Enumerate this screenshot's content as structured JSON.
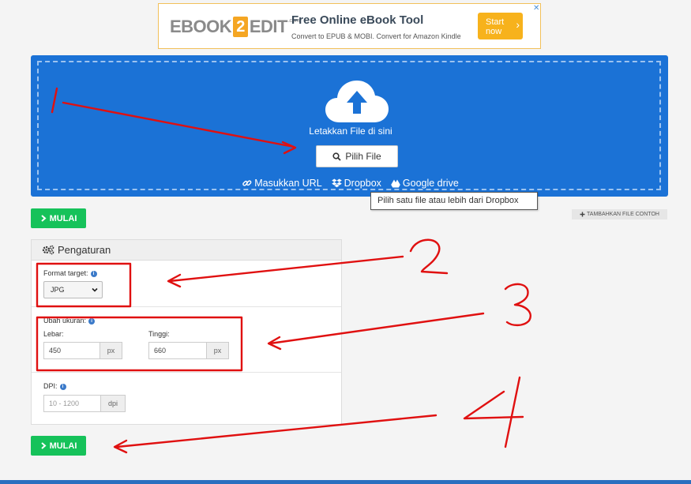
{
  "ad": {
    "logo_left": "EBOOK",
    "logo_num": "2",
    "logo_right": "EDIT",
    "logo_suffix": ".com",
    "title": "Free Online eBook Tool",
    "subtitle": "Convert to EPUB & MOBI. Convert for Amazon Kindle",
    "start_line1": "Start",
    "start_line2": "now",
    "close": "✕"
  },
  "upload": {
    "drop_text": "Letakkan File di sini",
    "pick_label": "Pilih File",
    "url_label": "Masukkan URL",
    "dropbox_label": "Dropbox",
    "gdrive_label": "Google drive"
  },
  "tooltip": "Pilih satu file atau lebih dari Dropbox",
  "actions": {
    "start_label": "MULAI",
    "sample_label": "TAMBAHKAN FILE CONTOH"
  },
  "settings": {
    "title": "Pengaturan",
    "format_label": "Format target:",
    "format_value": "JPG",
    "resize_label": "Ubah ukuran:",
    "width_label": "Lebar:",
    "width_value": "450",
    "width_unit": "px",
    "height_label": "Tinggi:",
    "height_value": "660",
    "height_unit": "px",
    "dpi_label": "DPI:",
    "dpi_placeholder": "10 - 1200",
    "dpi_unit": "dpi"
  },
  "annotations": [
    "1",
    "2",
    "3",
    "4"
  ],
  "colors": {
    "upload_bg": "#1b72d6",
    "button_green": "#16c25a",
    "annotation_red": "#e01010",
    "ad_orange": "#f7b21c"
  },
  "icons": [
    "cloud-upload-icon",
    "search-icon",
    "link-icon",
    "dropbox-icon",
    "google-drive-icon",
    "chevron-right-icon",
    "plus-icon",
    "gears-icon",
    "info-icon",
    "chevron-down-icon"
  ]
}
